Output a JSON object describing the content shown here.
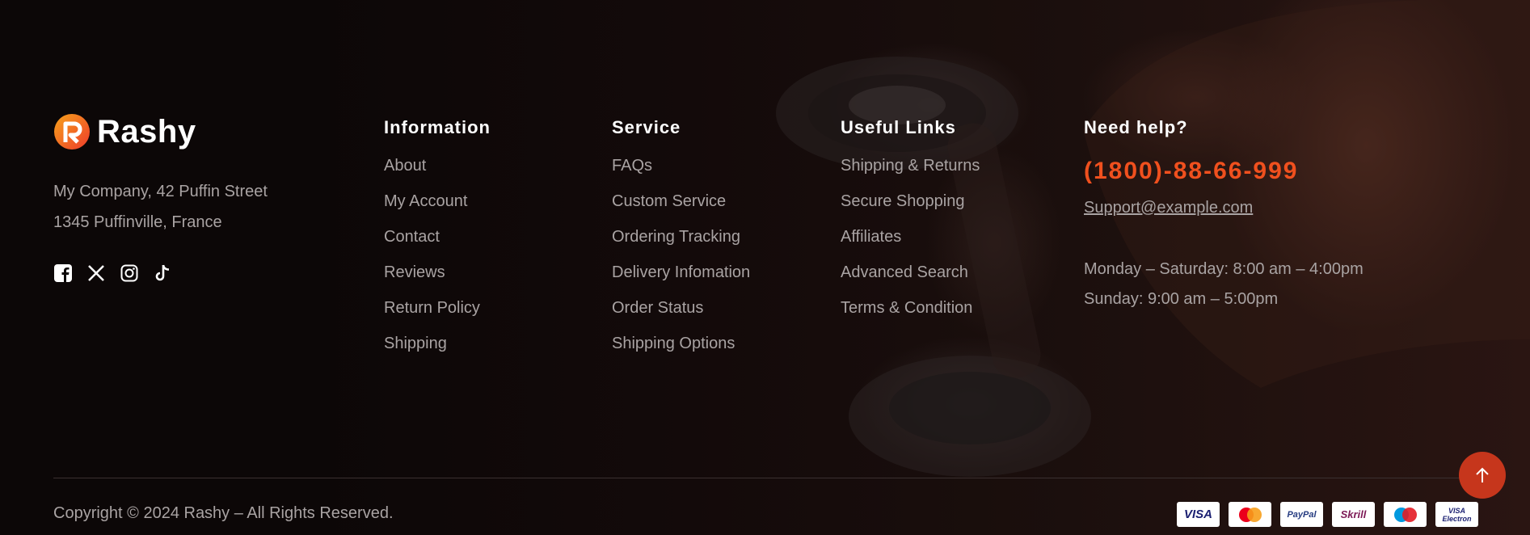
{
  "brand": {
    "name": "Rashy",
    "accent": "#f0501e"
  },
  "company": {
    "address_line1": "My Company, 42 Puffin Street",
    "address_line2": "1345 Puffinville, France"
  },
  "social": [
    "facebook-icon",
    "x-icon",
    "instagram-icon",
    "tiktok-icon"
  ],
  "columns": {
    "information": {
      "title": "Information",
      "items": [
        "About",
        "My Account",
        "Contact",
        "Reviews",
        "Return Policy",
        "Shipping"
      ]
    },
    "service": {
      "title": "Service",
      "items": [
        "FAQs",
        "Custom Service",
        "Ordering Tracking",
        "Delivery Infomation",
        "Order Status",
        "Shipping Options"
      ]
    },
    "useful_links": {
      "title": "Useful Links",
      "items": [
        "Shipping & Returns",
        "Secure Shopping",
        "Affiliates",
        "Advanced Search",
        "Terms & Condition"
      ]
    }
  },
  "help": {
    "title": "Need help?",
    "phone": "(1800)-88-66-999",
    "email": "Support@example.com",
    "hours_weekday": "Monday – Saturday: 8:00 am – 4:00pm",
    "hours_weekend": "Sunday: 9:00 am – 5:00pm"
  },
  "footer": {
    "copyright": "Copyright © 2024 Rashy – All Rights Reserved."
  },
  "payments": {
    "visa": "VISA",
    "mastercard": "MasterCard",
    "paypal": "PayPal",
    "skrill": "Skrill",
    "maestro": "Maestro",
    "visa_electron": "VISA Electron"
  }
}
